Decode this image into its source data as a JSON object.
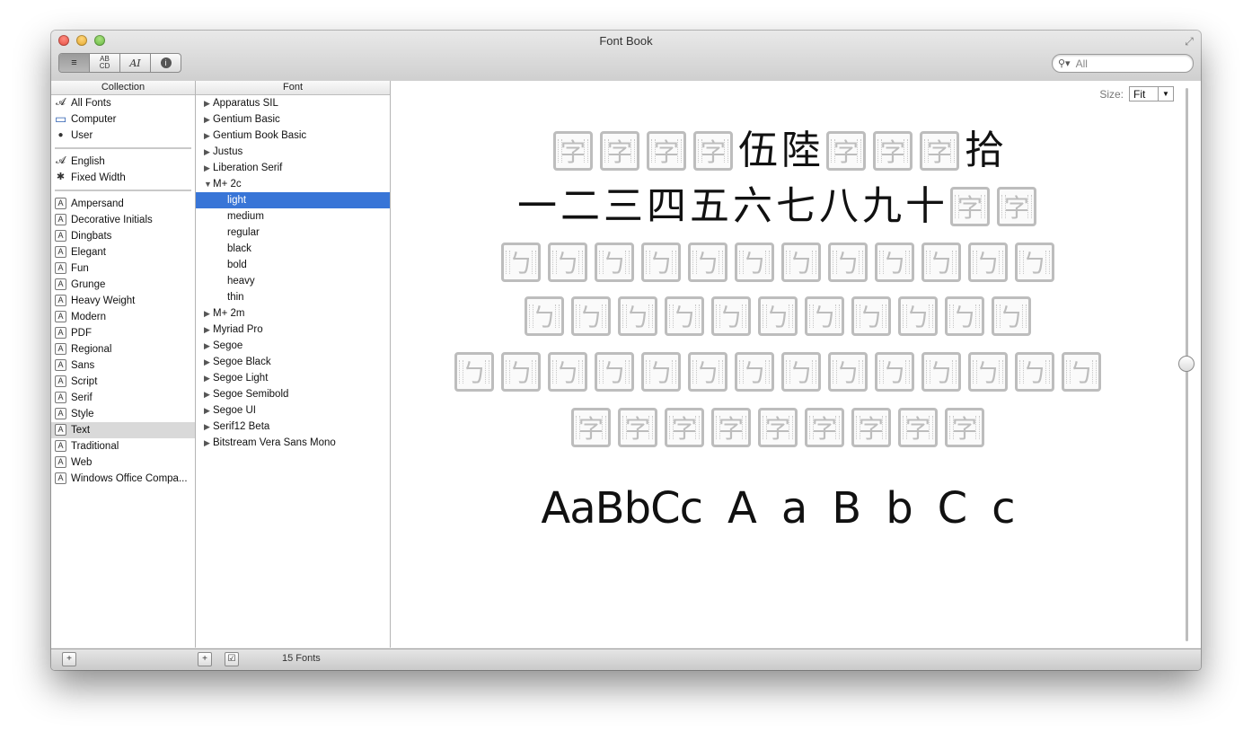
{
  "window": {
    "title": "Font Book"
  },
  "toolbar": {
    "view_buttons": [
      "≡",
      "ABCD",
      "AI",
      "i"
    ],
    "search_placeholder": "All"
  },
  "collection": {
    "header": "Collection",
    "library": [
      {
        "label": "All Fonts",
        "icon": "font-icon"
      },
      {
        "label": "Computer",
        "icon": "computer-icon"
      },
      {
        "label": "User",
        "icon": "user-icon"
      }
    ],
    "smart": [
      {
        "label": "English",
        "icon": "font-icon"
      },
      {
        "label": "Fixed Width",
        "icon": "gear-icon"
      }
    ],
    "collections": [
      "Ampersand",
      "Decorative Initials",
      "Dingbats",
      "Elegant",
      "Fun",
      "Grunge",
      "Heavy Weight",
      "Modern",
      "PDF",
      "Regional",
      "Sans",
      "Script",
      "Serif",
      "Style",
      "Text",
      "Traditional",
      "Web",
      "Windows Office Compa..."
    ],
    "selected": "Text"
  },
  "fonts": {
    "header": "Font",
    "rows": [
      {
        "label": "Apparatus SIL",
        "level": 0,
        "expanded": false
      },
      {
        "label": "Gentium Basic",
        "level": 0,
        "expanded": false
      },
      {
        "label": "Gentium Book Basic",
        "level": 0,
        "expanded": false
      },
      {
        "label": "Justus",
        "level": 0,
        "expanded": false
      },
      {
        "label": "Liberation Serif",
        "level": 0,
        "expanded": false
      },
      {
        "label": "M+ 2c",
        "level": 0,
        "expanded": true
      },
      {
        "label": "light",
        "level": 1
      },
      {
        "label": "medium",
        "level": 1
      },
      {
        "label": "regular",
        "level": 1
      },
      {
        "label": "black",
        "level": 1
      },
      {
        "label": "bold",
        "level": 1
      },
      {
        "label": "heavy",
        "level": 1
      },
      {
        "label": "thin",
        "level": 1
      },
      {
        "label": "M+ 2m",
        "level": 0,
        "expanded": false
      },
      {
        "label": "Myriad Pro",
        "level": 0,
        "expanded": false
      },
      {
        "label": "Segoe",
        "level": 0,
        "expanded": false
      },
      {
        "label": "Segoe Black",
        "level": 0,
        "expanded": false
      },
      {
        "label": "Segoe Light",
        "level": 0,
        "expanded": false
      },
      {
        "label": "Segoe Semibold",
        "level": 0,
        "expanded": false
      },
      {
        "label": "Segoe UI",
        "level": 0,
        "expanded": false
      },
      {
        "label": "Serif12 Beta",
        "level": 0,
        "expanded": false
      },
      {
        "label": "Bitstream Vera Sans Mono",
        "level": 0,
        "expanded": false
      }
    ],
    "selected": "light"
  },
  "preview": {
    "size_label": "Size:",
    "size_value": "Fit",
    "rows": [
      [
        {
          "t": "tofu",
          "c": "字"
        },
        {
          "t": "tofu",
          "c": "字"
        },
        {
          "t": "tofu",
          "c": "字"
        },
        {
          "t": "tofu",
          "c": "字"
        },
        {
          "t": "glyph",
          "c": "伍"
        },
        {
          "t": "glyph",
          "c": "陸"
        },
        {
          "t": "tofu",
          "c": "字"
        },
        {
          "t": "tofu",
          "c": "字"
        },
        {
          "t": "tofu",
          "c": "字"
        },
        {
          "t": "glyph",
          "c": "拾"
        }
      ],
      [
        {
          "t": "glyph",
          "c": "一"
        },
        {
          "t": "glyph",
          "c": "二"
        },
        {
          "t": "glyph",
          "c": "三"
        },
        {
          "t": "glyph",
          "c": "四"
        },
        {
          "t": "glyph",
          "c": "五"
        },
        {
          "t": "glyph",
          "c": "六"
        },
        {
          "t": "glyph",
          "c": "七"
        },
        {
          "t": "glyph",
          "c": "八"
        },
        {
          "t": "glyph",
          "c": "九"
        },
        {
          "t": "glyph",
          "c": "十"
        },
        {
          "t": "tofu",
          "c": "字"
        },
        {
          "t": "tofu",
          "c": "字"
        }
      ],
      {
        "tofu_count": 12,
        "c": "ㄅ"
      },
      {
        "tofu_count": 11,
        "c": "ㄅ"
      },
      {
        "tofu_count": 14,
        "c": "ㄅ"
      },
      {
        "tofu_count": 9,
        "c": "字"
      }
    ],
    "latin_a": "AaBbCc",
    "latin_b": [
      "A",
      "a",
      "B",
      "b",
      "C",
      "c"
    ]
  },
  "footer": {
    "count": "15 Fonts"
  }
}
